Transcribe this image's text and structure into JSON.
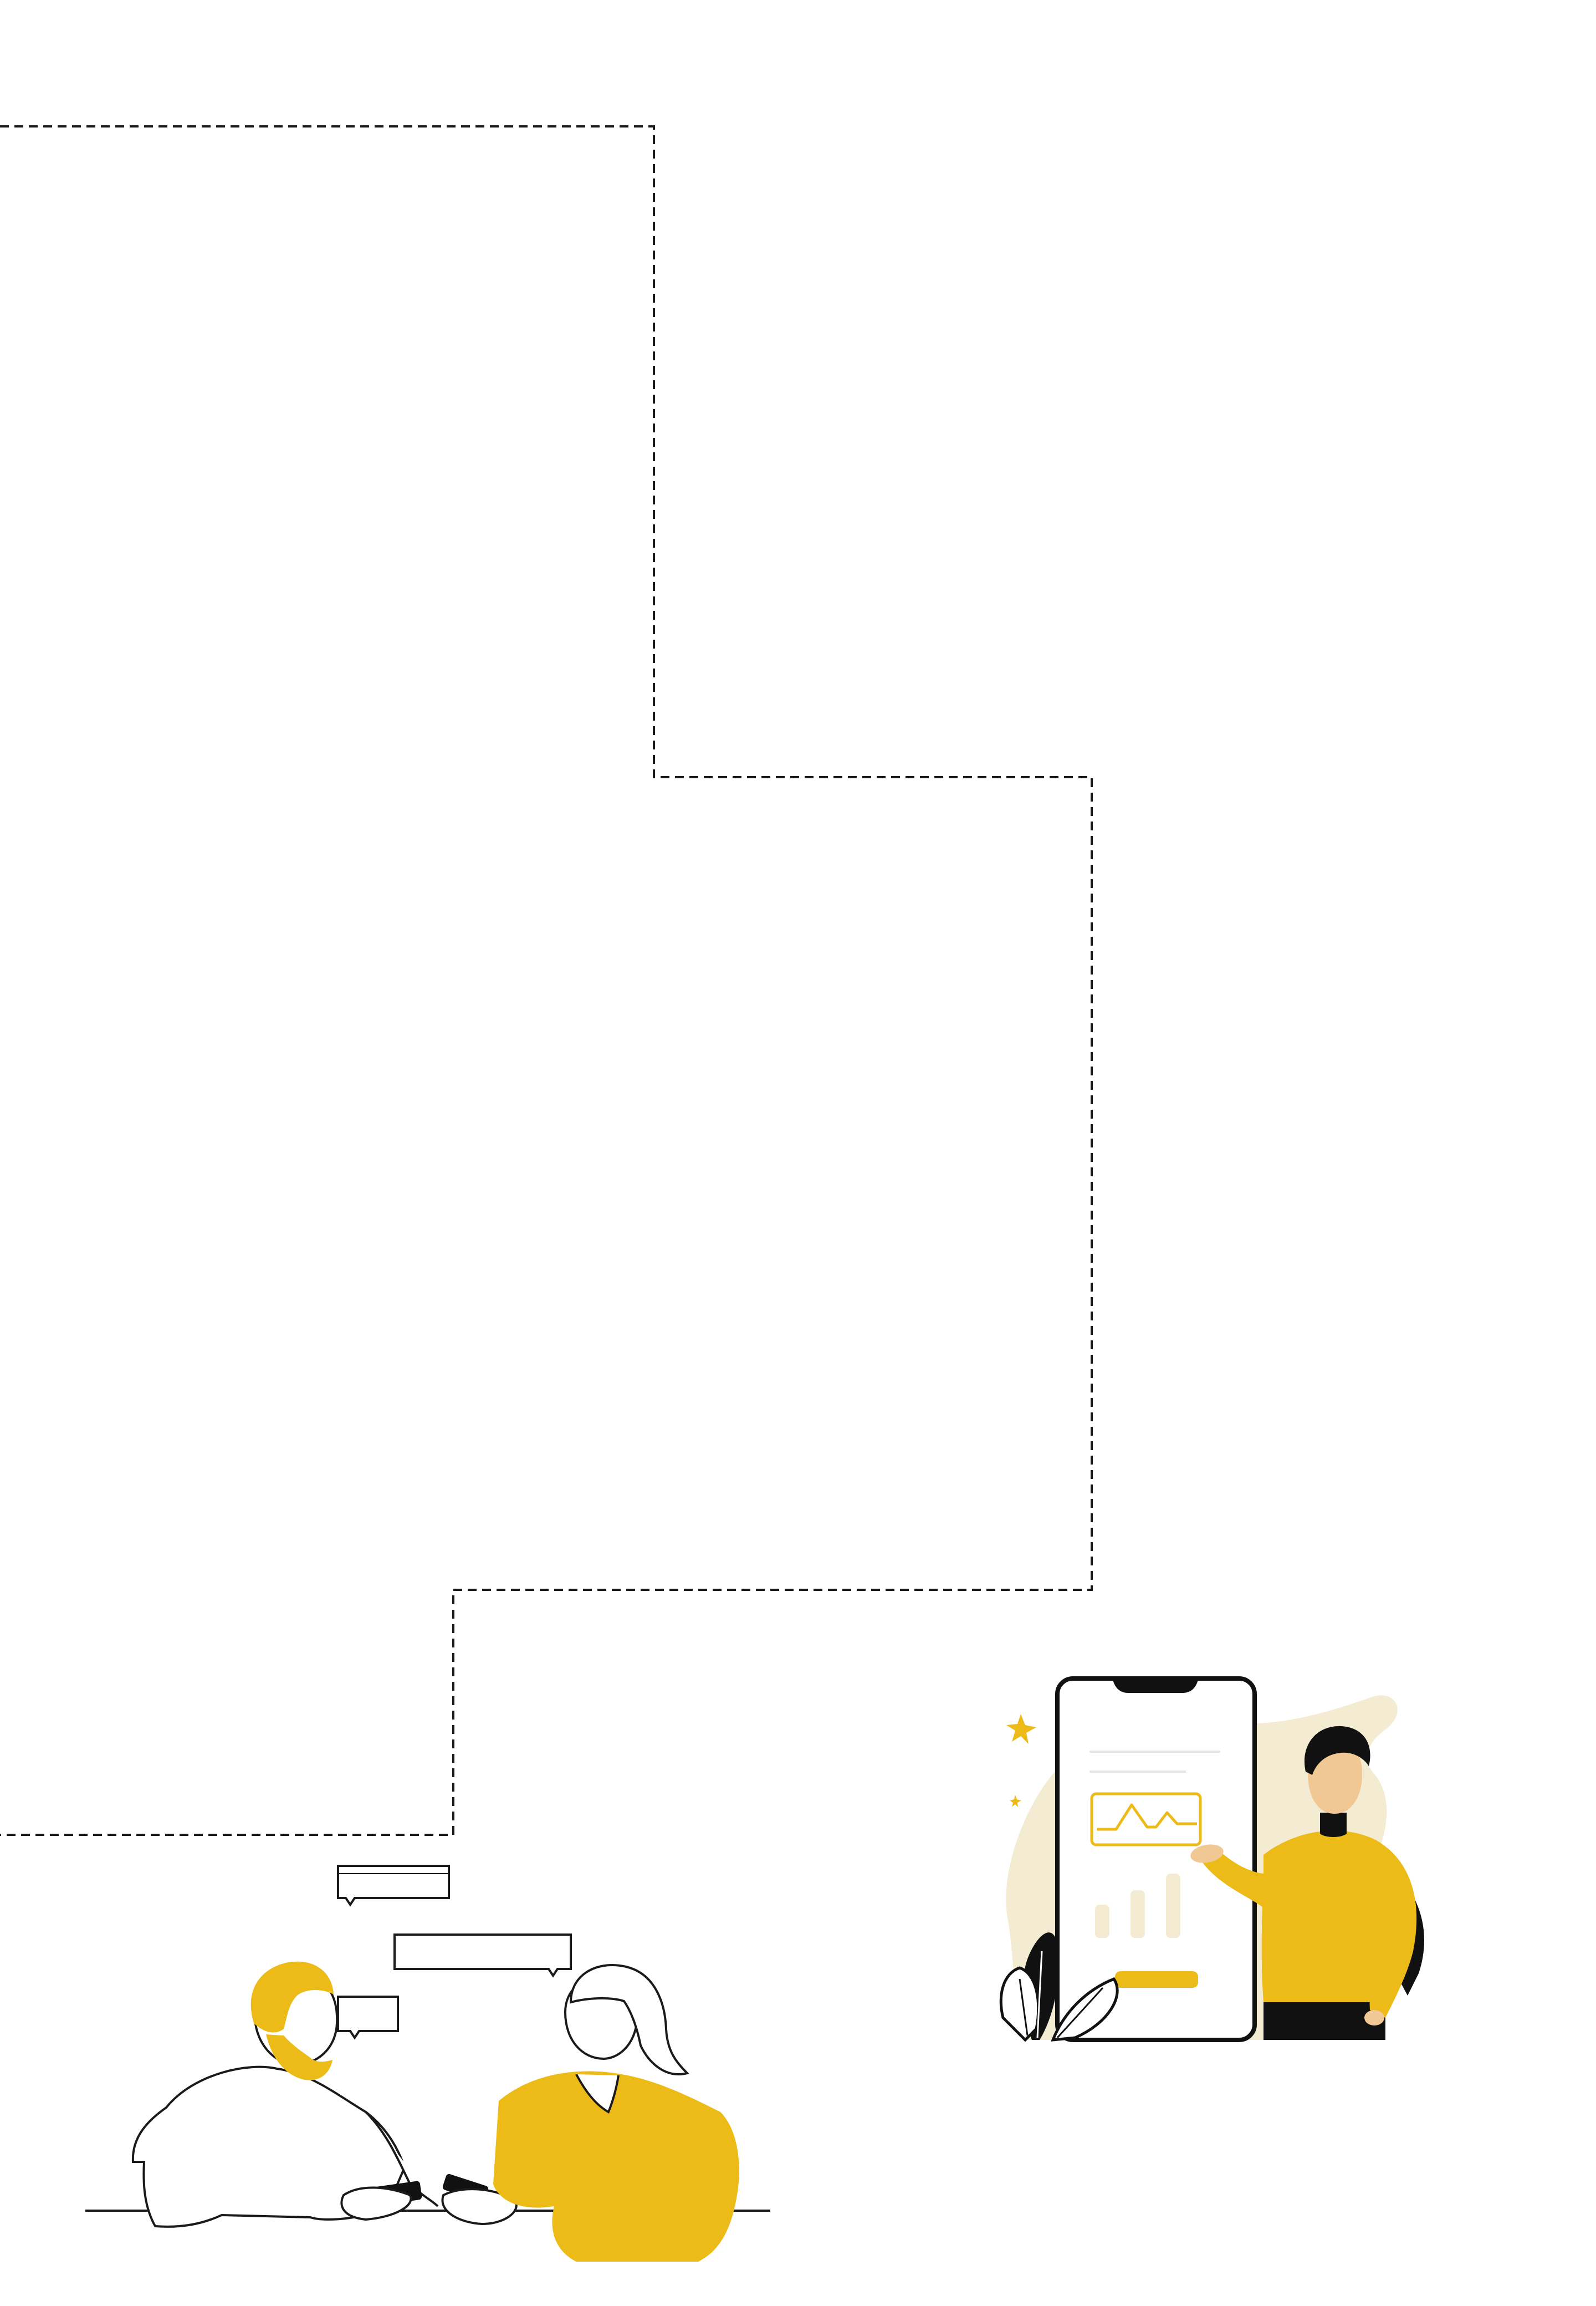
{
  "canvas": {
    "background": "#ffffff"
  },
  "colors": {
    "line": "#1a1a1a",
    "accent_yellow": "#ecbb17",
    "pale_yellow": "#f3ecd2",
    "skin": "#f1c893",
    "black": "#111111",
    "white": "#ffffff"
  },
  "icons": {
    "stepped_outline": "dashed-stepped-border",
    "left_illustration": "two-people-with-phones-illustration",
    "right_illustration": "man-presenting-phone-dashboard-illustration"
  }
}
